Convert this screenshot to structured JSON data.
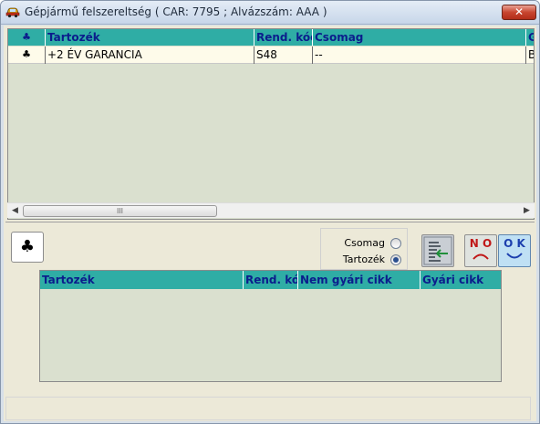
{
  "window": {
    "title": "Gépjármű felszereltség ( CAR: 7795 ; Alvázszám: AAA )",
    "close_label": "✕"
  },
  "top_grid": {
    "headers": [
      "♣",
      "Tartozék",
      "Rend. kód",
      "Csomag",
      "G"
    ],
    "rows": [
      [
        "♣",
        "+2 ÉV GARANCIA",
        "S48",
        "--",
        "B"
      ]
    ],
    "scroll_thumb_grip": "III"
  },
  "controls": {
    "club_button_symbol": "♣",
    "radio_options": [
      {
        "label": "Csomag",
        "selected": false
      },
      {
        "label": "Tartozék",
        "selected": true
      }
    ],
    "icons": [
      "list-edit-icon",
      "no-face-icon",
      "ok-face-icon"
    ],
    "no_text": "N O",
    "ok_text": "O K"
  },
  "bottom_grid": {
    "headers": [
      "Tartozék",
      "Rend. kód",
      "Nem gyári cikk",
      "Gyári cikk"
    ]
  },
  "colors": {
    "header_bg": "#2fada5",
    "header_text": "#0b1d8c",
    "grid_bg": "#dae0cf",
    "row_bg": "#fefbea"
  }
}
